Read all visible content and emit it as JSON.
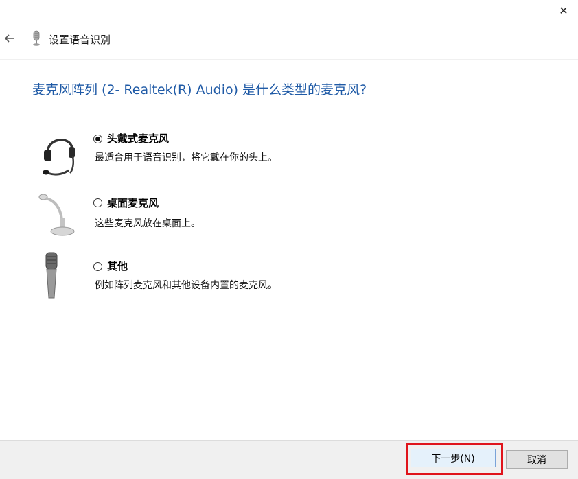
{
  "window": {
    "close_glyph": "✕"
  },
  "header": {
    "title": "设置语音识别",
    "back_icon": "arrow-left-icon",
    "app_icon": "microphone-icon"
  },
  "main": {
    "heading": "麦克风阵列 (2- Realtek(R) Audio) 是什么类型的麦克风?",
    "options": [
      {
        "label": "头戴式麦克风",
        "description": "最适合用于语音识别，将它戴在你的头上。",
        "selected": true,
        "icon": "headset-icon"
      },
      {
        "label": "桌面麦克风",
        "description": "这些麦克风放在桌面上。",
        "selected": false,
        "icon": "desktop-microphone-icon"
      },
      {
        "label": "其他",
        "description": "例如阵列麦克风和其他设备内置的麦克风。",
        "selected": false,
        "icon": "handheld-microphone-icon"
      }
    ]
  },
  "footer": {
    "next_label": "下一步(N)",
    "cancel_label": "取消"
  },
  "colors": {
    "heading": "#1f5aa6",
    "highlight": "#e0141b",
    "footer_bg": "#f0f0f0"
  }
}
